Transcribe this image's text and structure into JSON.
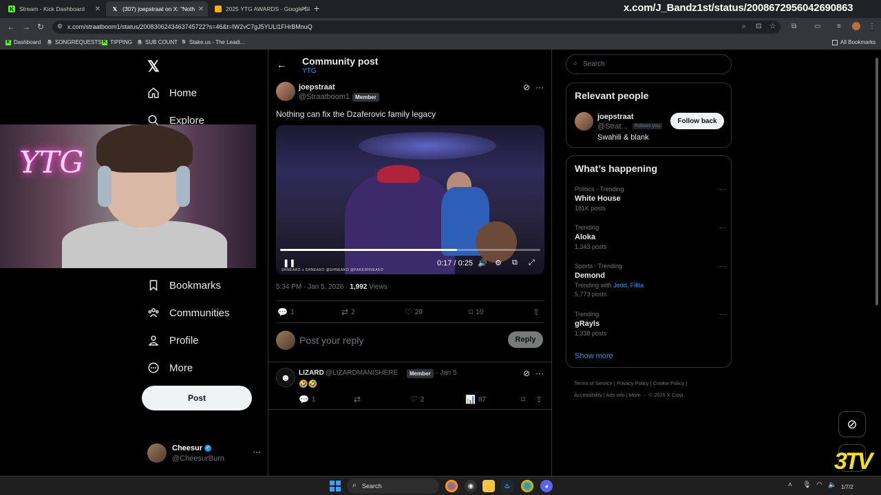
{
  "browser": {
    "tabs": [
      {
        "title": "Stream - Kick Dashboard",
        "active": false
      },
      {
        "title": "(307) joepstraat on X: \"Noth",
        "active": true
      },
      {
        "title": "2025 YTG AWARDS - Google Sl",
        "active": false
      }
    ],
    "url_overlay": "x.com/J_Bandz1st/status/2008672956042690863",
    "url": "x.com/straatboom1/status/2008306243463745722?s=46&t=IW2vC7gJ5YULl1FHrBMnuQ",
    "bookmarks": [
      "Dashboard",
      "SONGREQUESTS",
      "TIPPING",
      "SUB COUNT",
      "Stake.us - The Leadi...",
      "All Bookmarks"
    ]
  },
  "nav": {
    "items": [
      {
        "label": "Home",
        "icon": "home-icon"
      },
      {
        "label": "Explore",
        "icon": "search-icon"
      },
      {
        "label": "Bookmarks",
        "icon": "bookmark-icon"
      },
      {
        "label": "Communities",
        "icon": "communities-icon"
      },
      {
        "label": "Profile",
        "icon": "profile-icon"
      },
      {
        "label": "More",
        "icon": "more-circle-icon"
      }
    ],
    "post_button": "Post",
    "account": {
      "name": "Cheesur",
      "handle": "@CheesurBurn"
    }
  },
  "webcam": {
    "neon_text": "YTG"
  },
  "main": {
    "header_title": "Community post",
    "header_sub": "YTG",
    "post": {
      "name": "joepstraat",
      "handle": "@Straatboom1",
      "badge": "Member",
      "text": "Nothing can fix the Dzaferovic family legacy",
      "video": {
        "time": "0:17 / 0:25",
        "progress": 0.68,
        "watermark": "SHNEAKO x SHNEAKO @SHNEAKO @FAKESHNEAKO"
      },
      "time": "5:34 PM · Jan 5, 2026 ·",
      "views_count": "1,992",
      "views_label": "Views",
      "replies": "1",
      "reposts": "2",
      "likes": "29",
      "bookmarks": "10"
    },
    "reply_placeholder": "Post your reply",
    "reply_button": "Reply",
    "comment": {
      "name": "LIZARD",
      "handle": "@LIZARDMANISHERE",
      "badge": "Member",
      "date": "· Jan 5",
      "text": "🤣🤣",
      "replies": "1",
      "likes": "2",
      "views": "87"
    }
  },
  "sidebar": {
    "search_placeholder": "Search",
    "relevant": {
      "title": "Relevant people",
      "name": "joepstraat",
      "handle": "@Strat...",
      "follows_you": "Follows you",
      "bio": "Swahili & blank",
      "button": "Follow back"
    },
    "happening": {
      "title": "What’s happening",
      "trends": [
        {
          "category": "Politics · Trending",
          "name": "White House",
          "with": "",
          "count": "181K posts"
        },
        {
          "category": "Trending",
          "name": "Aloka",
          "with": "",
          "count": "1,343 posts"
        },
        {
          "category": "Sports · Trending",
          "name": "Demond",
          "with_label": "Trending with",
          "with": "Jedd, Fifita",
          "count": "5,773 posts"
        },
        {
          "category": "Trending",
          "name": "gRayls",
          "with": "",
          "count": "1,338 posts"
        }
      ],
      "show_more": "Show more"
    },
    "footer_line1": "Terms of Service  |  Privacy Policy  |  Cookie Policy  |",
    "footer_line2": "Accessibility  |  Ads info  |  More ···  © 2026 X Corp."
  },
  "taskbar": {
    "search": "Search",
    "clock": "1/7/2"
  },
  "colors": {
    "accent": "#1d9bf0",
    "bg": "#000000",
    "border": "#2f3336",
    "muted": "#71767b"
  }
}
